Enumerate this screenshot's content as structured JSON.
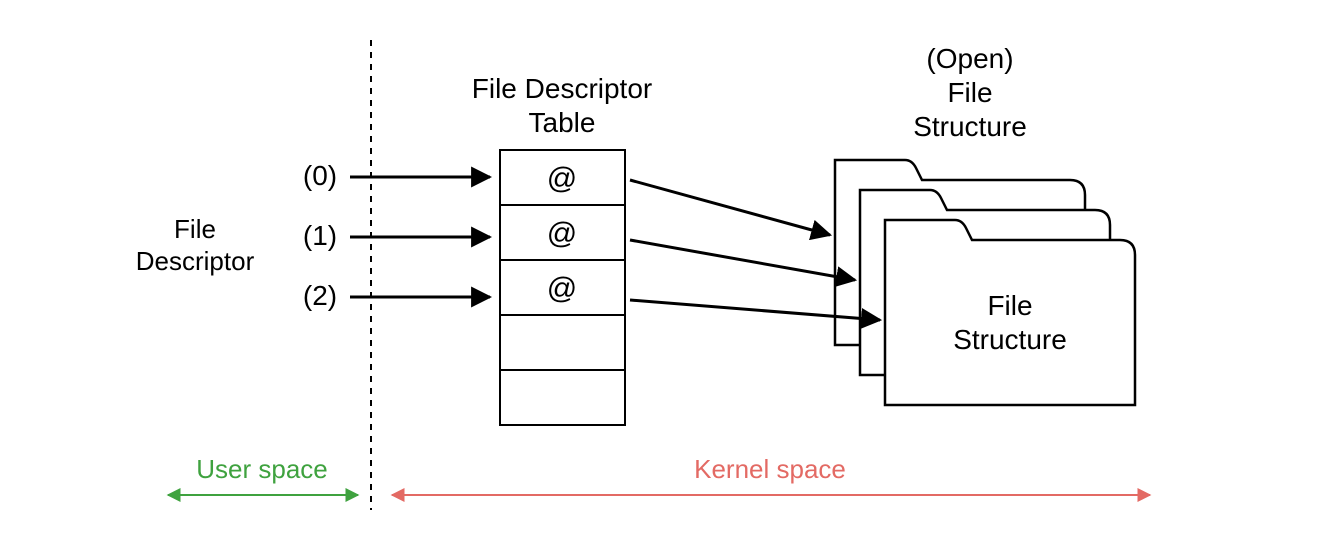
{
  "labels": {
    "file_descriptor_line1": "File",
    "file_descriptor_line2": "Descriptor",
    "fd_table_line1": "File Descriptor",
    "fd_table_line2": "Table",
    "open_file_line1": "(Open)",
    "open_file_line2": "File",
    "open_file_line3": "Structure",
    "file_struct_line1": "File",
    "file_struct_line2": "Structure",
    "user_space": "User space",
    "kernel_space": "Kernel space"
  },
  "fds": {
    "fd0": "(0)",
    "fd1": "(1)",
    "fd2": "(2)"
  },
  "table_cells": {
    "c0": "@",
    "c1": "@",
    "c2": "@",
    "c3": "",
    "c4": ""
  }
}
